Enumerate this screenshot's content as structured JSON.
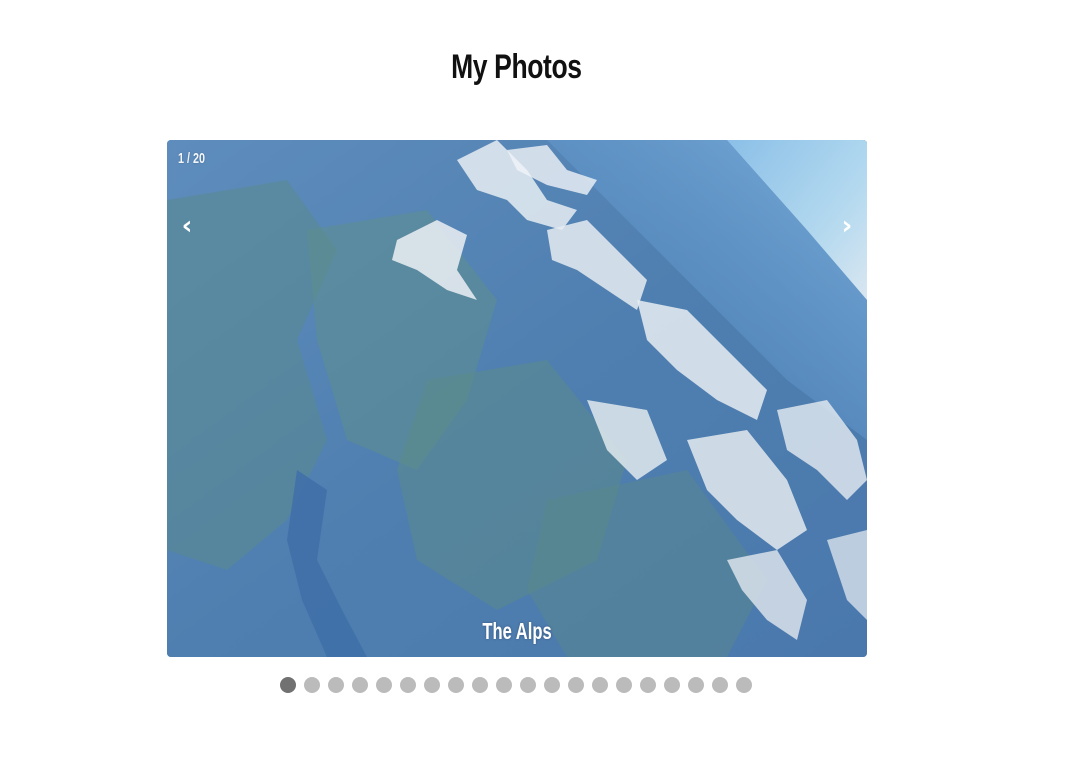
{
  "gallery": {
    "title": "My Photos",
    "counter": "1 / 20",
    "caption": "The Alps",
    "prev_icon": "‹",
    "next_icon": "›",
    "total_slides": 20,
    "active_slide": 1
  },
  "colors": {
    "dot_inactive": "#bbbbbb",
    "dot_active": "#717171"
  }
}
